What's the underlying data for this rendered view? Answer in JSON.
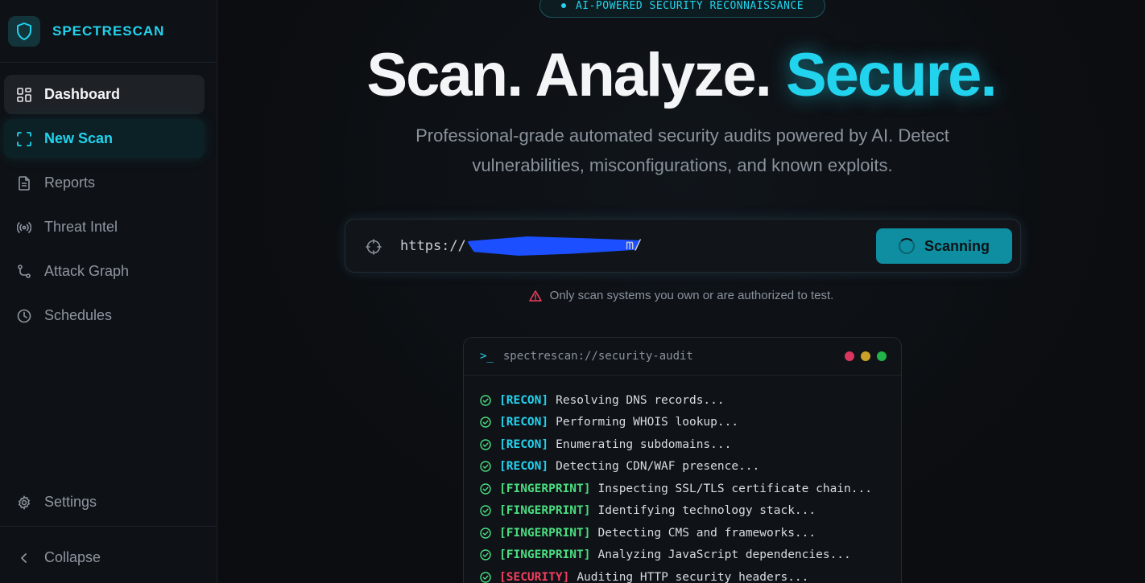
{
  "brand": {
    "name": "SPECTRESCAN"
  },
  "sidebar": {
    "items": [
      {
        "label": "Dashboard",
        "icon": "grid-icon"
      },
      {
        "label": "New Scan",
        "icon": "scan-frame-icon"
      },
      {
        "label": "Reports",
        "icon": "document-icon"
      },
      {
        "label": "Threat Intel",
        "icon": "broadcast-icon"
      },
      {
        "label": "Attack Graph",
        "icon": "graph-icon"
      },
      {
        "label": "Schedules",
        "icon": "clock-icon"
      }
    ],
    "settings_label": "Settings",
    "collapse_label": "Collapse"
  },
  "hero": {
    "badge": "AI-POWERED SECURITY RECONNAISSANCE",
    "headline_part1": "Scan. Analyze. ",
    "headline_accent": "Secure.",
    "subtitle": "Professional-grade automated security audits powered by AI. Detect vulnerabilities, misconfigurations, and known exploits."
  },
  "scan": {
    "url_prefix": "https://",
    "url_suffix": "m/",
    "button_label": "Scanning",
    "warning": "Only scan systems you own or are authorized to test."
  },
  "terminal": {
    "prompt": ">_",
    "title": "spectrescan://security-audit",
    "lines": [
      {
        "tag": "[RECON]",
        "text": "Resolving DNS records..."
      },
      {
        "tag": "[RECON]",
        "text": "Performing WHOIS lookup..."
      },
      {
        "tag": "[RECON]",
        "text": "Enumerating subdomains..."
      },
      {
        "tag": "[RECON]",
        "text": "Detecting CDN/WAF presence..."
      },
      {
        "tag": "[FINGERPRINT]",
        "text": "Inspecting SSL/TLS certificate chain..."
      },
      {
        "tag": "[FINGERPRINT]",
        "text": "Identifying technology stack..."
      },
      {
        "tag": "[FINGERPRINT]",
        "text": "Detecting CMS and frameworks..."
      },
      {
        "tag": "[FINGERPRINT]",
        "text": "Analyzing JavaScript dependencies..."
      },
      {
        "tag": "[SECURITY]",
        "text": "Auditing HTTP security headers..."
      }
    ]
  },
  "colors": {
    "accent": "#22d3ee",
    "recon": "#22d3ee",
    "fingerprint": "#4ade80",
    "security": "#f43f5e",
    "dot_red": "#d9365f",
    "dot_yellow": "#c9a227",
    "dot_green": "#22b34a"
  }
}
